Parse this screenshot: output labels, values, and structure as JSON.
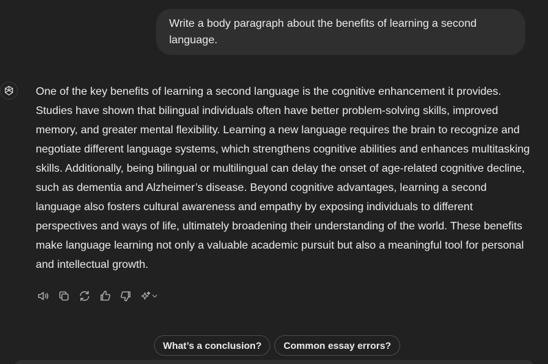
{
  "conversation": {
    "user_message": "Write a body paragraph about the benefits of learning a second language.",
    "assistant_message": "One of the key benefits of learning a second language is the cognitive enhancement it provides. Studies have shown that bilingual individuals often have better problem-solving skills, improved memory, and greater mental flexibility. Learning a new language requires the brain to recognize and negotiate different language systems, which strengthens cognitive abilities and enhances multitasking skills. Additionally, being bilingual or multilingual can delay the onset of age-related cognitive decline, such as dementia and Alzheimer’s disease. Beyond cognitive advantages, learning a second language also fosters cultural awareness and empathy by exposing individuals to different perspectives and ways of life, ultimately broadening their understanding of the world. These benefits make language learning not only a valuable academic pursuit but also a meaningful tool for personal and intellectual growth."
  },
  "assistant_avatar_icon": "openai-logo-icon",
  "actions": [
    {
      "icon": "read-aloud-icon"
    },
    {
      "icon": "copy-icon"
    },
    {
      "icon": "regenerate-icon"
    },
    {
      "icon": "thumbs-up-icon"
    },
    {
      "icon": "thumbs-down-icon"
    },
    {
      "icon": "sparkle-model-icon"
    }
  ],
  "suggestions": [
    {
      "label": "What’s a conclusion?"
    },
    {
      "label": "Common essay errors?"
    }
  ],
  "colors": {
    "background": "#212121",
    "bubble": "#2f2f2f",
    "text": "#ececec",
    "icon": "#b4b4b4"
  }
}
